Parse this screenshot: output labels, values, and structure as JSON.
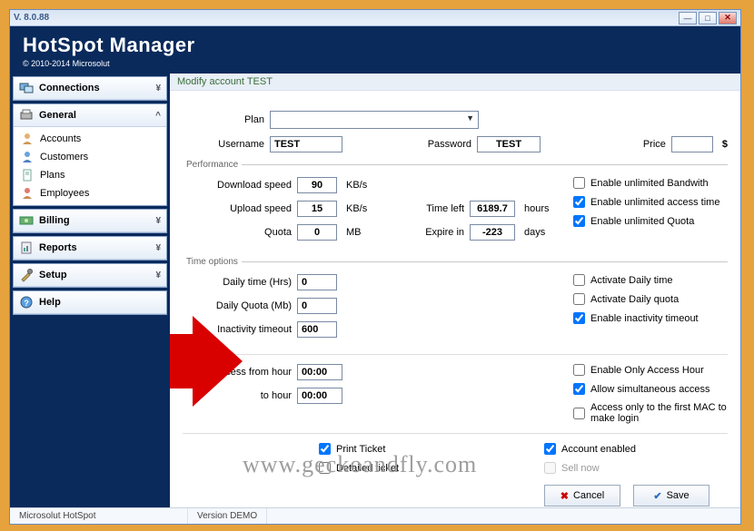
{
  "window": {
    "title": "V.  8.0.88"
  },
  "header": {
    "title": "HotSpot Manager",
    "copyright": "© 2010-2014 Microsolut"
  },
  "sidebar": {
    "connections": {
      "label": "Connections"
    },
    "general": {
      "label": "General",
      "items": [
        {
          "label": "Accounts"
        },
        {
          "label": "Customers"
        },
        {
          "label": "Plans"
        },
        {
          "label": "Employees"
        }
      ]
    },
    "billing": {
      "label": "Billing"
    },
    "reports": {
      "label": "Reports"
    },
    "setup": {
      "label": "Setup"
    },
    "help": {
      "label": "Help"
    }
  },
  "crumb": "Modify account   TEST",
  "form": {
    "plan_label": "Plan",
    "plan_value": "",
    "username_label": "Username",
    "username_value": "TEST",
    "password_label": "Password",
    "password_value": "TEST",
    "price_label": "Price",
    "price_value": "",
    "price_unit": "$",
    "performance_legend": "Performance",
    "download_label": "Download speed",
    "download_value": "90",
    "upload_label": "Upload speed",
    "upload_value": "15",
    "speed_unit": "KB/s",
    "quota_label": "Quota",
    "quota_value": "0",
    "quota_unit": "MB",
    "timeleft_label": "Time left",
    "timeleft_value": "6189.7",
    "timeleft_unit": "hours",
    "expire_label": "Expire in",
    "expire_value": "-223",
    "expire_unit": "days",
    "enable_bw": "Enable unlimited Bandwith",
    "enable_time": "Enable unlimited access time",
    "enable_quota": "Enable unlimited Quota",
    "time_legend": "Time options",
    "dailytime_label": "Daily time (Hrs)",
    "dailytime_value": "0",
    "dailyquota_label": "Daily Quota (Mb)",
    "dailyquota_value": "0",
    "inactivity_label": "Inactivity timeout",
    "inactivity_value": "600",
    "activate_dt": "Activate Daily time",
    "activate_dq": "Activate Daily quota",
    "enable_inact": "Enable inactivity timeout",
    "access_from_label": "Access from hour",
    "access_from_value": "00:00",
    "access_to_label": "to hour",
    "access_to_value": "00:00",
    "enable_access_hour": "Enable Only Access Hour",
    "allow_sim": "Allow simultaneous access",
    "first_mac": "Access only to the first MAC to make login",
    "print_ticket": "Print Ticket",
    "detailed_ticket": "Detailed ticket",
    "account_enabled": "Account enabled",
    "sell_now": "Sell now",
    "cancel": "Cancel",
    "save": "Save"
  },
  "statusbar": {
    "left": "Microsolut HotSpot",
    "right": "Version DEMO"
  },
  "watermark": "www.geckoandfly.com"
}
